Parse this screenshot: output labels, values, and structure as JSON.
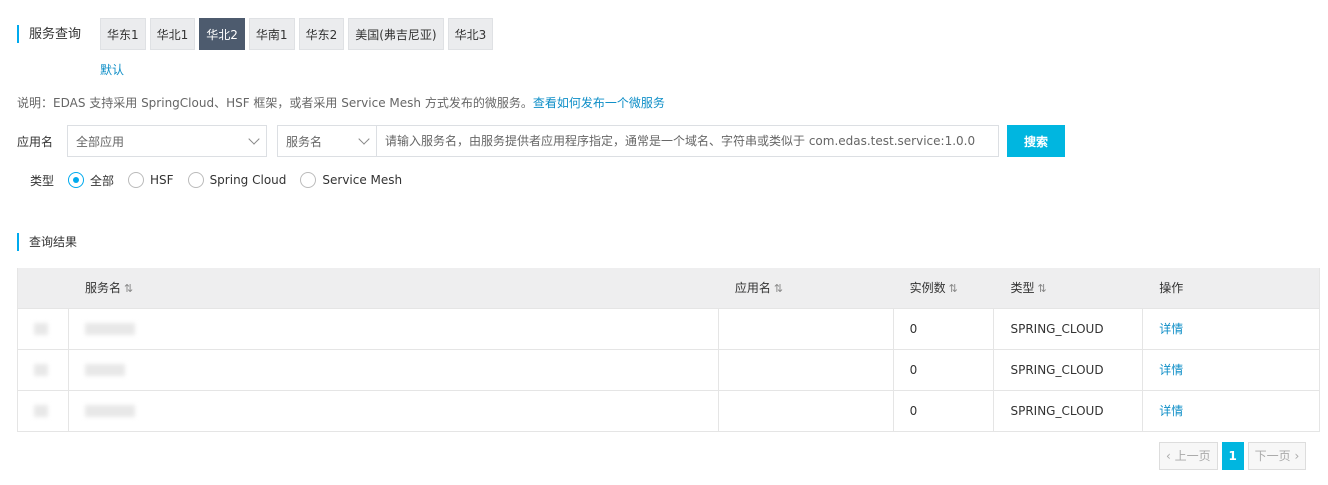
{
  "service_query": {
    "title": "服务查询"
  },
  "regions": [
    {
      "label": "华东1",
      "active": false
    },
    {
      "label": "华北1",
      "active": false
    },
    {
      "label": "华北2",
      "active": true
    },
    {
      "label": "华南1",
      "active": false
    },
    {
      "label": "华东2",
      "active": false
    },
    {
      "label": "美国(弗吉尼亚)",
      "active": false
    },
    {
      "label": "华北3",
      "active": false
    }
  ],
  "default_label": "默认",
  "description": {
    "text": "说明：EDAS 支持采用 SpringCloud、HSF 框架，或者采用 Service Mesh 方式发布的微服务。",
    "link": "查看如何发布一个微服务"
  },
  "search": {
    "app_label": "应用名",
    "app_select": "全部应用",
    "field_select": "服务名",
    "placeholder": "请输入服务名，由服务提供者应用程序指定，通常是一个域名、字符串或类似于 com.edas.test.service:1.0.0",
    "button": "搜索"
  },
  "type_filter": {
    "label": "类型",
    "options": [
      "全部",
      "HSF",
      "Spring Cloud",
      "Service Mesh"
    ]
  },
  "results": {
    "title": "查询结果",
    "columns": [
      "服务名",
      "应用名",
      "实例数",
      "类型",
      "操作"
    ],
    "rows": [
      {
        "instances": "0",
        "type": "SPRING_CLOUD",
        "action": "详情"
      },
      {
        "instances": "0",
        "type": "SPRING_CLOUD",
        "action": "详情"
      },
      {
        "instances": "0",
        "type": "SPRING_CLOUD",
        "action": "详情"
      }
    ]
  },
  "pagination": {
    "prev": "上一页",
    "current": "1",
    "next": "下一页"
  },
  "colors": {
    "accent": "#00aaee",
    "link": "#0e8ec7",
    "button": "#00b6e0",
    "active_tab": "#4d5b6e"
  }
}
